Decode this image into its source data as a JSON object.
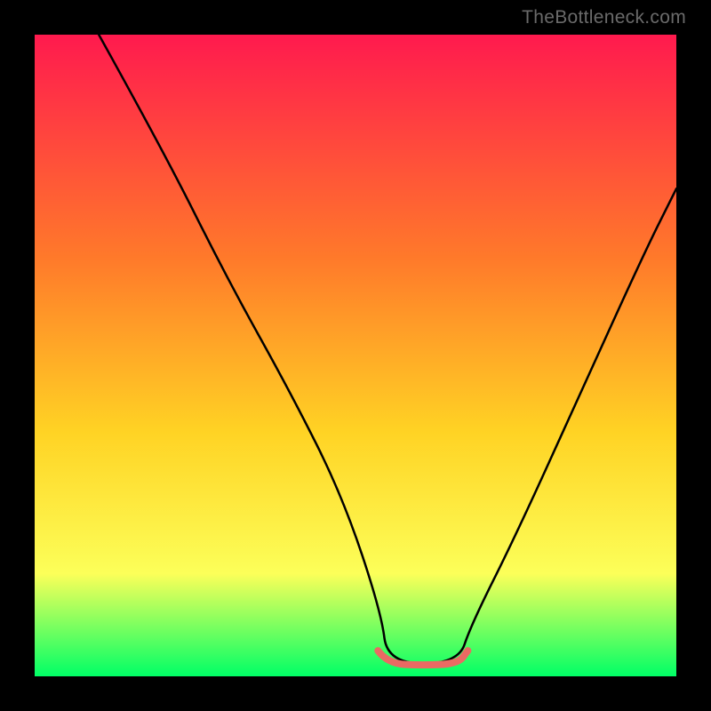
{
  "watermark": "TheBottleneck.com",
  "colors": {
    "frame": "#000000",
    "curve_black": "#000000",
    "curve_red": "#ea6a63",
    "grad_top": "#ff1a4e",
    "grad_mid1": "#ff7a2a",
    "grad_mid2": "#ffd324",
    "grad_mid3": "#fcff59",
    "grad_bottom": "#00ff66"
  },
  "chart_data": {
    "type": "line",
    "title": "",
    "xlabel": "",
    "ylabel": "",
    "xlim": [
      0,
      100
    ],
    "ylim": [
      0,
      100
    ],
    "notch_band": {
      "x_start": 55,
      "x_end": 66,
      "y": 2
    },
    "series": [
      {
        "name": "black-curve",
        "x": [
          10,
          20,
          30,
          40,
          48,
          54,
          55,
          66,
          68,
          75,
          85,
          95,
          100
        ],
        "values": [
          100,
          82,
          62,
          44,
          28,
          10,
          2,
          2,
          8,
          22,
          44,
          66,
          76
        ]
      }
    ]
  }
}
